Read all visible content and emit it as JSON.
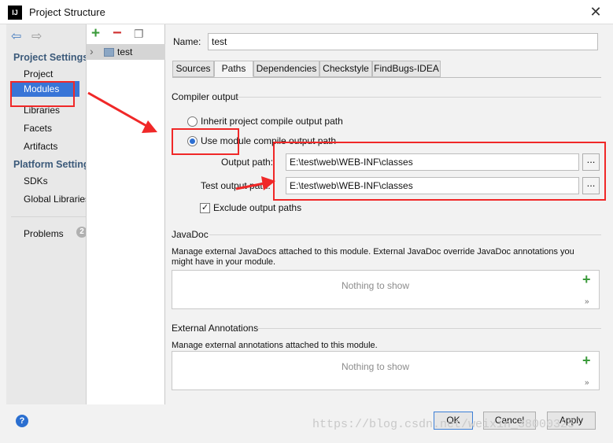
{
  "window": {
    "title": "Project Structure",
    "app_icon_text": "IJ",
    "close_glyph": "✕"
  },
  "nav": {
    "back_glyph": "⇦",
    "forward_glyph": "⇨",
    "project_settings": "Project Settings",
    "items_project": [
      "Project",
      "Modules",
      "Libraries",
      "Facets",
      "Artifacts"
    ],
    "platform_settings": "Platform Settings",
    "items_platform": [
      "SDKs",
      "Global Libraries"
    ],
    "problems": "Problems",
    "problems_count": "2"
  },
  "tree": {
    "add_glyph": "+",
    "remove_glyph": "−",
    "copy_glyph": "❐",
    "module_name": "test",
    "expand_glyph": "›"
  },
  "main": {
    "name_label": "Name:",
    "name_value": "test",
    "tabs": [
      "Sources",
      "Paths",
      "Dependencies",
      "Checkstyle",
      "FindBugs-IDEA"
    ],
    "active_tab": "Paths",
    "compiler_output": "Compiler output",
    "inherit_label": "Inherit project compile output path",
    "use_module_label": "Use module compile output path",
    "output_path_label": "Output path:",
    "output_path_value": "E:\\test\\web\\WEB-INF\\classes",
    "test_output_label": "Test output path:",
    "test_output_value": "E:\\test\\web\\WEB-INF\\classes",
    "browse_glyph": "...",
    "exclude_label": "Exclude output paths",
    "check_glyph": "✓",
    "javadoc_title": "JavaDoc",
    "javadoc_desc": "Manage external JavaDocs attached to this module. External JavaDoc override JavaDoc annotations you might have in your module.",
    "nothing_to_show": "Nothing to show",
    "plus_glyph": "+",
    "more_glyph": "»",
    "ext_title": "External Annotations",
    "ext_desc": "Manage external annotations attached to this module."
  },
  "footer": {
    "help_glyph": "?",
    "ok": "OK",
    "cancel": "Cancel",
    "apply": "Apply"
  },
  "watermark": "https://blog.csdn.net/weixin_38000325",
  "colors": {
    "annotation_red": "#f02828",
    "selection_blue": "#3875d7"
  }
}
